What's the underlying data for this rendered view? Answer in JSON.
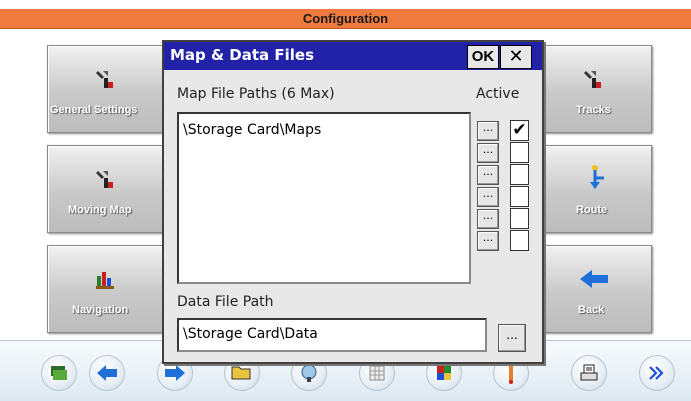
{
  "app": {
    "title": "Configuration"
  },
  "tiles": {
    "general_settings": "General Settings",
    "moving_map": "Moving Map",
    "navigation": "Navigation",
    "tracks": "Tracks",
    "route": "Route",
    "back": "Back"
  },
  "dialog": {
    "title": "Map & Data Files",
    "ok_label": "OK",
    "close_label": "✕",
    "map_paths_label": "Map File Paths (6 Max)",
    "active_label": "Active",
    "map_paths": [
      "\\Storage Card\\Maps",
      "",
      "",
      "",
      "",
      ""
    ],
    "active": [
      true,
      false,
      false,
      false,
      false,
      false
    ],
    "browse_label": "...",
    "data_path_label": "Data File Path",
    "data_path_value": "\\Storage Card\\Data"
  },
  "toolbar": {
    "icons": [
      "layers-icon",
      "arrow-left-icon",
      "arrow-right-icon",
      "folder-icon",
      "gps-icon",
      "grid-icon",
      "color-grid-icon",
      "marker-icon",
      "printer-icon",
      "more-icon"
    ]
  },
  "colors": {
    "title_bar": "#f0793e",
    "dialog_title": "#2222a8",
    "arrow_blue": "#1e6fd8"
  }
}
